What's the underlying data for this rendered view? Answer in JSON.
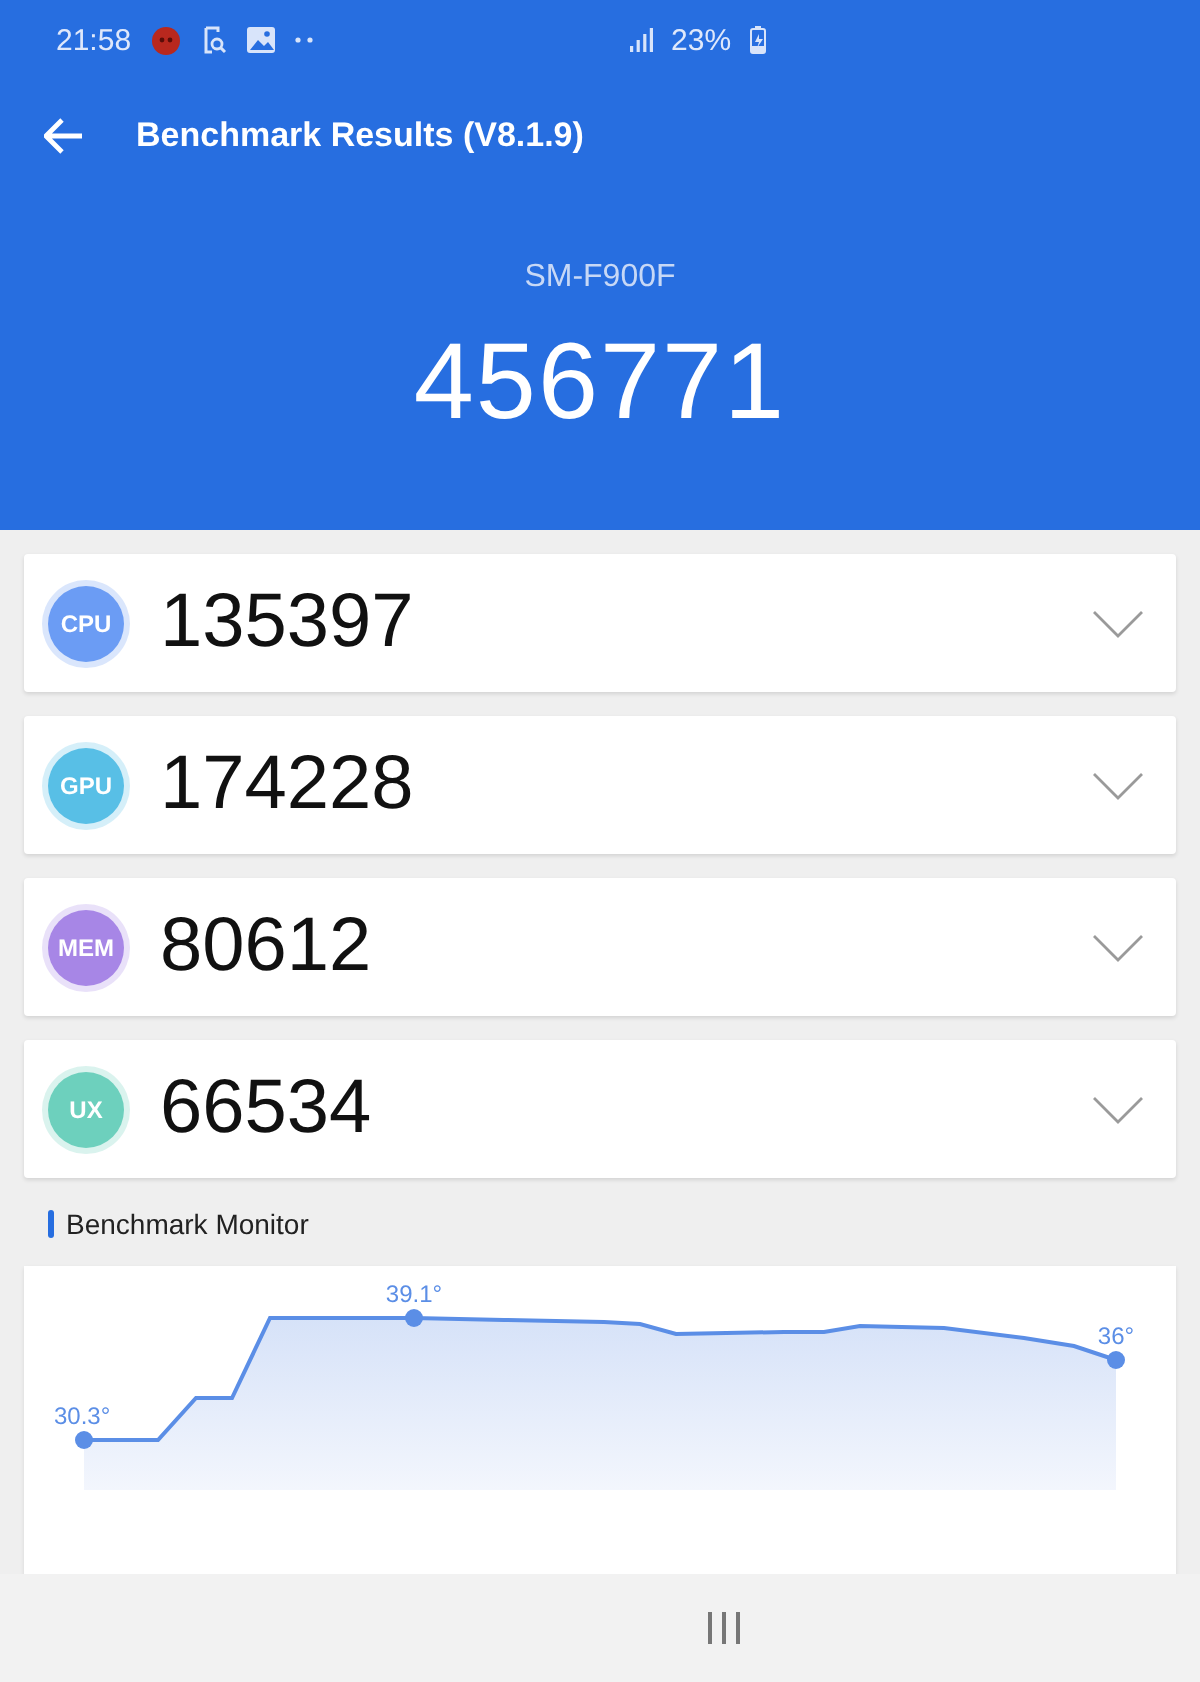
{
  "status_bar": {
    "time": "21:58",
    "battery": "23%"
  },
  "toolbar": {
    "title": "Benchmark Results (V8.1.9)"
  },
  "summary": {
    "device": "SM-F900F",
    "total_score": "456771"
  },
  "scores": [
    {
      "badge": "CPU",
      "score": "135397",
      "color": "#6b9cf4",
      "expanded": false
    },
    {
      "badge": "GPU",
      "score": "174228",
      "color": "#58bfe6",
      "expanded": false
    },
    {
      "badge": "MEM",
      "score": "80612",
      "color": "#a786e6",
      "expanded": false
    },
    {
      "badge": "UX",
      "score": "66534",
      "color": "#6dd0bd",
      "expanded": false
    }
  ],
  "monitor": {
    "title": "Benchmark Monitor",
    "point_labels": [
      "30.3°",
      "39.1°",
      "36°"
    ]
  }
}
